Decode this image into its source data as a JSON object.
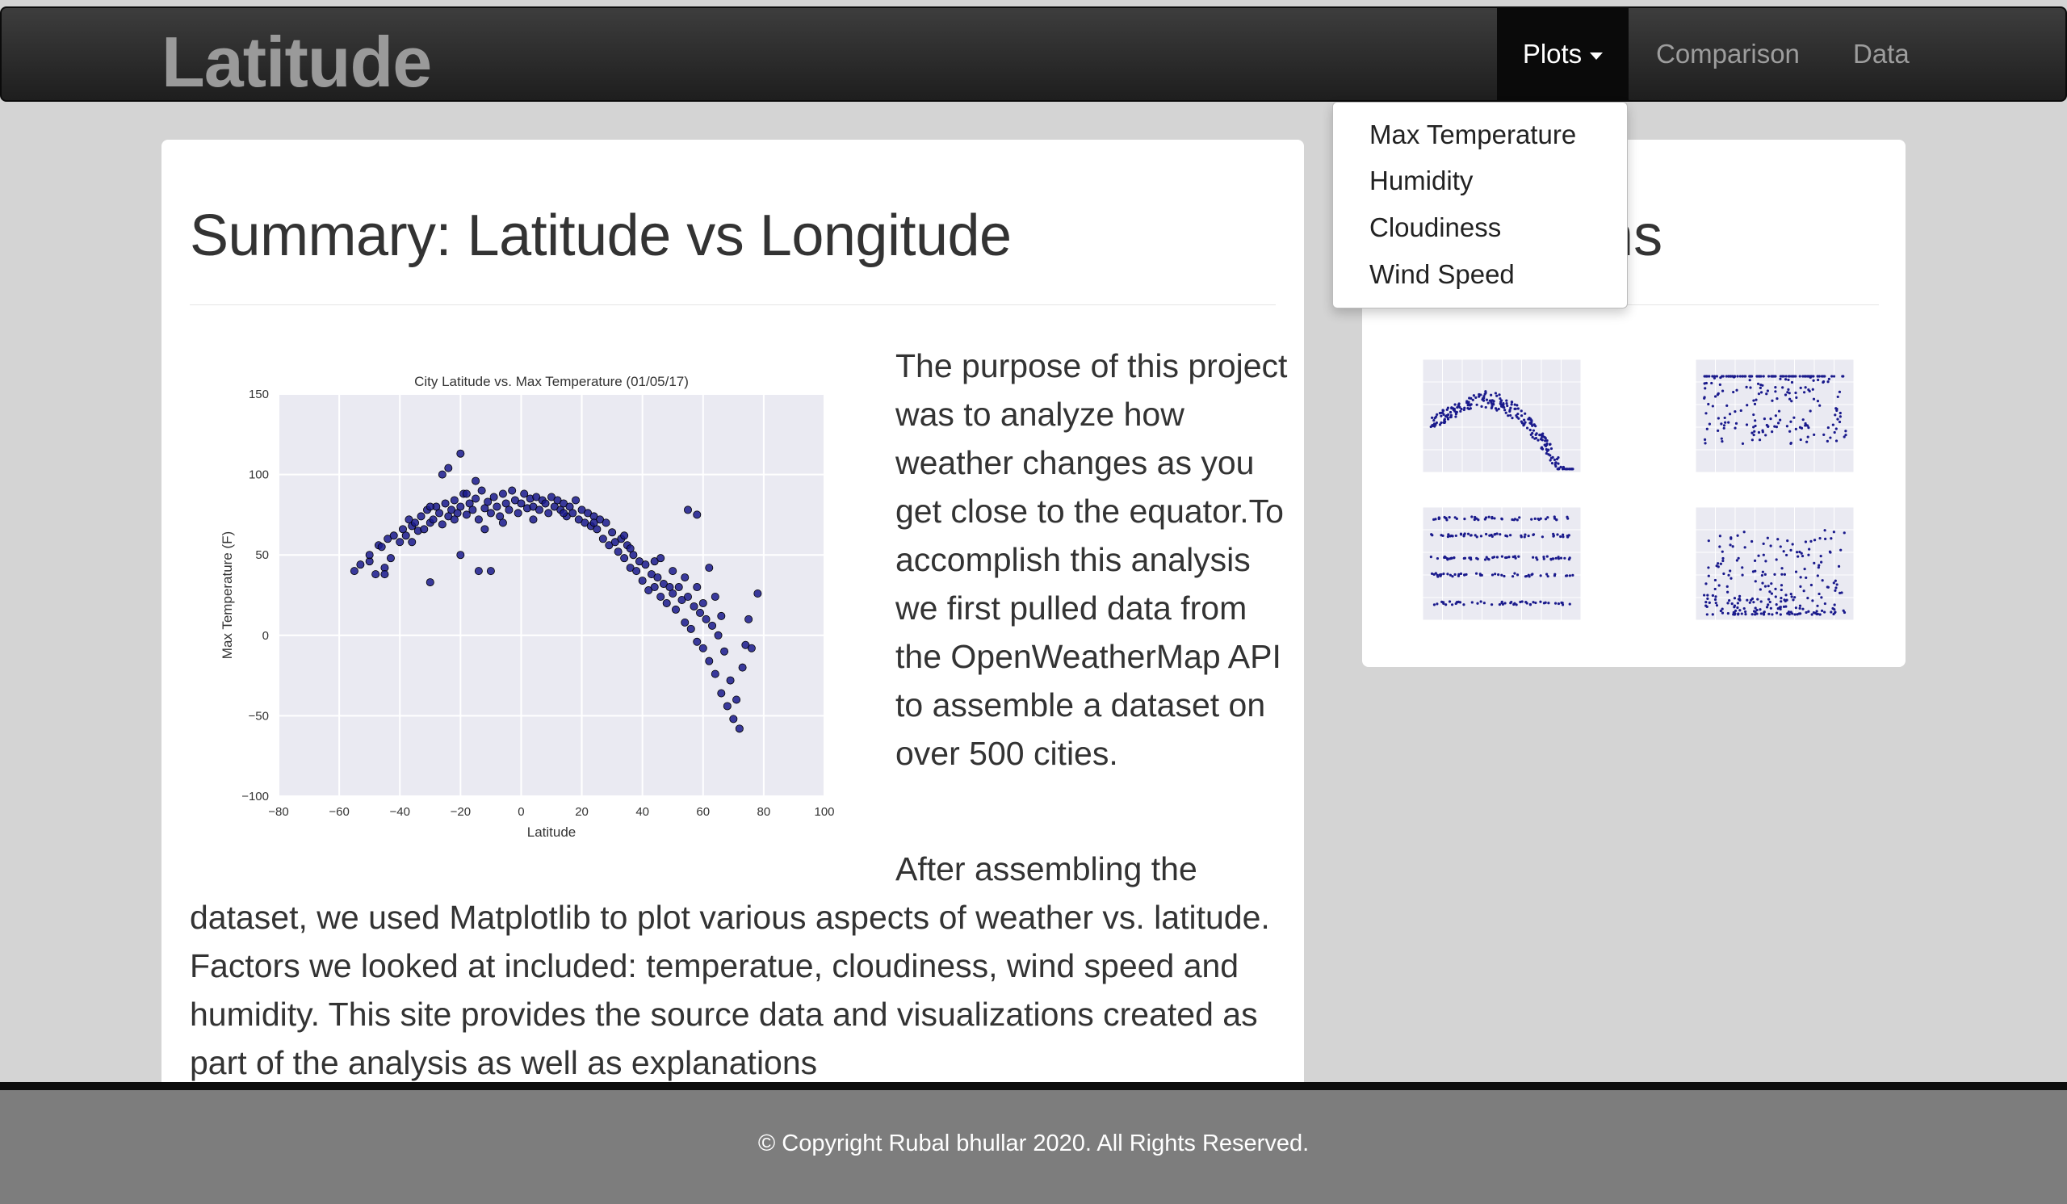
{
  "navbar": {
    "brand": "Latitude",
    "plots_label": "Plots",
    "comparison_label": "Comparison",
    "data_label": "Data"
  },
  "dropdown": {
    "items": [
      "Max Temperature",
      "Humidity",
      "Cloudiness",
      "Wind Speed"
    ]
  },
  "main": {
    "heading": "Summary: Latitude vs Longitude",
    "para1": "The purpose of this project was to analyze how weather changes as you get close to the equator.To accomplish this analysis we first pulled data from the OpenWeatherMap API to assemble a dataset on over 500 cities.",
    "para2_start": "After assembling the",
    "para2_rest": "dataset, we used Matplotlib to plot various aspects of weather vs. latitude. Factors we looked at included: temperatue, cloudiness, wind speed and humidity. This site provides the source data and visualizations created as part of the analysis as well as explanations"
  },
  "side": {
    "heading_visible": "tions"
  },
  "footer": {
    "copyright": "© Copyright Rubal bhullar 2020. All Rights Reserved."
  },
  "chart_data": {
    "type": "scatter",
    "title": "City Latitude vs. Max Temperature (01/05/17)",
    "xlabel": "Latitude",
    "ylabel": "Max Temperature (F)",
    "xlim": [
      -80,
      100
    ],
    "ylim": [
      -100,
      150
    ],
    "xticks": [
      "−80",
      "−60",
      "−40",
      "−20",
      "0",
      "20",
      "40",
      "60",
      "80",
      "100"
    ],
    "yticks": [
      "150",
      "100",
      "50",
      "0",
      "−50",
      "−100"
    ],
    "grid": true,
    "point_color": "#1a1a8c",
    "points": [
      [
        -55,
        40
      ],
      [
        -53,
        44
      ],
      [
        -50,
        46
      ],
      [
        -48,
        38
      ],
      [
        -47,
        56
      ],
      [
        -46,
        55
      ],
      [
        -45,
        42
      ],
      [
        -44,
        60
      ],
      [
        -43,
        48
      ],
      [
        -42,
        62
      ],
      [
        -40,
        58
      ],
      [
        -39,
        66
      ],
      [
        -38,
        62
      ],
      [
        -37,
        72
      ],
      [
        -36,
        68
      ],
      [
        -35,
        70
      ],
      [
        -34,
        65
      ],
      [
        -33,
        74
      ],
      [
        -32,
        66
      ],
      [
        -31,
        78
      ],
      [
        -30,
        70
      ],
      [
        -29,
        72
      ],
      [
        -28,
        80
      ],
      [
        -27,
        76
      ],
      [
        -26,
        69
      ],
      [
        -25,
        82
      ],
      [
        -24,
        74
      ],
      [
        -23,
        78
      ],
      [
        -22,
        84
      ],
      [
        -21,
        76
      ],
      [
        -20,
        80
      ],
      [
        -19,
        88
      ],
      [
        -18,
        75
      ],
      [
        -17,
        82
      ],
      [
        -16,
        78
      ],
      [
        -15,
        85
      ],
      [
        -14,
        72
      ],
      [
        -13,
        90
      ],
      [
        -12,
        79
      ],
      [
        -11,
        83
      ],
      [
        -10,
        76
      ],
      [
        -9,
        86
      ],
      [
        -8,
        80
      ],
      [
        -7,
        74
      ],
      [
        -6,
        88
      ],
      [
        -5,
        82
      ],
      [
        -4,
        78
      ],
      [
        -3,
        90
      ],
      [
        -2,
        84
      ],
      [
        -1,
        76
      ],
      [
        0,
        82
      ],
      [
        1,
        88
      ],
      [
        2,
        79
      ],
      [
        3,
        85
      ],
      [
        4,
        80
      ],
      [
        5,
        86
      ],
      [
        6,
        78
      ],
      [
        7,
        84
      ],
      [
        8,
        82
      ],
      [
        9,
        76
      ],
      [
        10,
        86
      ],
      [
        11,
        80
      ],
      [
        12,
        84
      ],
      [
        13,
        78
      ],
      [
        14,
        82
      ],
      [
        15,
        74
      ],
      [
        16,
        80
      ],
      [
        17,
        76
      ],
      [
        18,
        84
      ],
      [
        19,
        72
      ],
      [
        20,
        78
      ],
      [
        21,
        70
      ],
      [
        22,
        76
      ],
      [
        23,
        68
      ],
      [
        24,
        74
      ],
      [
        25,
        66
      ],
      [
        26,
        72
      ],
      [
        27,
        60
      ],
      [
        28,
        70
      ],
      [
        29,
        56
      ],
      [
        30,
        64
      ],
      [
        31,
        58
      ],
      [
        32,
        52
      ],
      [
        33,
        60
      ],
      [
        34,
        48
      ],
      [
        35,
        56
      ],
      [
        36,
        42
      ],
      [
        37,
        50
      ],
      [
        38,
        40
      ],
      [
        39,
        46
      ],
      [
        40,
        34
      ],
      [
        41,
        44
      ],
      [
        42,
        28
      ],
      [
        43,
        38
      ],
      [
        44,
        30
      ],
      [
        45,
        36
      ],
      [
        46,
        24
      ],
      [
        47,
        32
      ],
      [
        48,
        20
      ],
      [
        49,
        30
      ],
      [
        50,
        26
      ],
      [
        51,
        16
      ],
      [
        52,
        30
      ],
      [
        53,
        22
      ],
      [
        54,
        8
      ],
      [
        55,
        24
      ],
      [
        56,
        4
      ],
      [
        57,
        18
      ],
      [
        58,
        -4
      ],
      [
        59,
        14
      ],
      [
        60,
        -8
      ],
      [
        61,
        10
      ],
      [
        62,
        -16
      ],
      [
        63,
        6
      ],
      [
        64,
        -24
      ],
      [
        65,
        0
      ],
      [
        66,
        -36
      ],
      [
        67,
        -10
      ],
      [
        68,
        -44
      ],
      [
        69,
        -28
      ],
      [
        70,
        -52
      ],
      [
        71,
        -40
      ],
      [
        72,
        -58
      ],
      [
        73,
        -20
      ],
      [
        74,
        -6
      ],
      [
        75,
        10
      ],
      [
        76,
        -8
      ],
      [
        78,
        26
      ],
      [
        62,
        42
      ],
      [
        58,
        30
      ],
      [
        55,
        78
      ],
      [
        58,
        75
      ],
      [
        -24,
        104
      ],
      [
        -20,
        113
      ],
      [
        -26,
        100
      ],
      [
        -15,
        96
      ],
      [
        -18,
        88
      ],
      [
        -30,
        33
      ],
      [
        -20,
        50
      ],
      [
        -14,
        40
      ],
      [
        -10,
        40
      ],
      [
        -45,
        38
      ],
      [
        -50,
        50
      ],
      [
        -36,
        58
      ],
      [
        -30,
        80
      ],
      [
        -22,
        72
      ],
      [
        -12,
        66
      ],
      [
        -6,
        70
      ],
      [
        4,
        72
      ],
      [
        14,
        76
      ],
      [
        24,
        70
      ],
      [
        34,
        62
      ],
      [
        44,
        46
      ],
      [
        54,
        36
      ],
      [
        64,
        24
      ],
      [
        66,
        12
      ],
      [
        60,
        20
      ],
      [
        50,
        40
      ],
      [
        46,
        48
      ],
      [
        36,
        54
      ]
    ]
  }
}
